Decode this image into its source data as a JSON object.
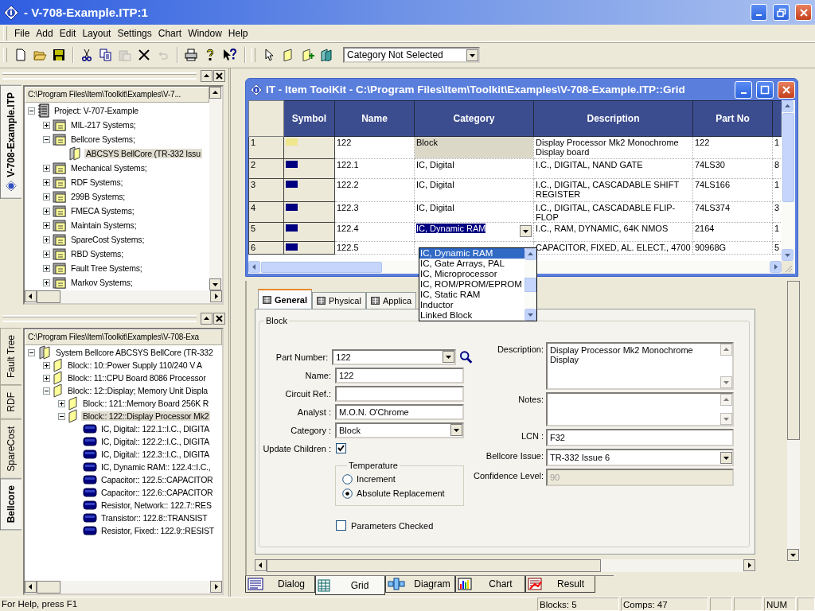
{
  "app": {
    "title": "- V-708-Example.ITP:1"
  },
  "menu": [
    "File",
    "Add",
    "Edit",
    "Layout",
    "Settings",
    "Chart",
    "Window",
    "Help"
  ],
  "toolbar": [
    {
      "kind": "new",
      "disabled": false
    },
    {
      "kind": "open",
      "disabled": false
    },
    {
      "kind": "save",
      "disabled": false
    },
    {
      "kind": "sep"
    },
    {
      "kind": "cut",
      "disabled": false
    },
    {
      "kind": "copy",
      "disabled": false
    },
    {
      "kind": "paste",
      "disabled": true
    },
    {
      "kind": "delete",
      "disabled": false
    },
    {
      "kind": "undo",
      "disabled": true
    },
    {
      "kind": "sep"
    },
    {
      "kind": "print",
      "disabled": false
    },
    {
      "kind": "help",
      "disabled": false
    },
    {
      "kind": "whatsthis",
      "disabled": false
    },
    {
      "kind": "bigsep"
    },
    {
      "kind": "pointer",
      "disabled": false
    },
    {
      "kind": "block",
      "disabled": false
    },
    {
      "kind": "addblock",
      "disabled": false
    },
    {
      "kind": "component",
      "disabled": false
    }
  ],
  "category_filter": {
    "value": "Category Not Selected"
  },
  "project_panel": {
    "tab": "V-708-Example.ITP",
    "path": "C:\\Program Files\\Item\\Toolkit\\Examples\\V-7...",
    "tree": [
      {
        "label": "Project:  V-707-Example",
        "kind": "project",
        "expanded": true,
        "selected": false,
        "children": [
          {
            "label": "MIL-217 Systems;",
            "kind": "folder",
            "expanded": false,
            "selected": false
          },
          {
            "label": "Bellcore Systems;",
            "kind": "folder",
            "expanded": true,
            "selected": false,
            "children": [
              {
                "label": "ABCSYS BellCore (TR-332 Issu",
                "kind": "system",
                "selected": true
              }
            ]
          },
          {
            "label": "Mechanical Systems;",
            "kind": "folder",
            "expanded": false,
            "selected": false
          },
          {
            "label": "RDF Systems;",
            "kind": "folder",
            "expanded": false,
            "selected": false
          },
          {
            "label": "299B Systems;",
            "kind": "folder",
            "expanded": false,
            "selected": false
          },
          {
            "label": "FMECA Systems;",
            "kind": "folder",
            "expanded": false,
            "selected": false
          },
          {
            "label": "Maintain Systems;",
            "kind": "folder",
            "expanded": false,
            "selected": false
          },
          {
            "label": "SpareCost Systems;",
            "kind": "folder",
            "expanded": false,
            "selected": false
          },
          {
            "label": "RBD Systems;",
            "kind": "folder",
            "expanded": false,
            "selected": false
          },
          {
            "label": "Fault Tree Systems;",
            "kind": "folder",
            "expanded": false,
            "selected": false
          },
          {
            "label": "Markov Systems;",
            "kind": "folder",
            "expanded": false,
            "selected": false
          }
        ]
      }
    ]
  },
  "system_panel": {
    "tabs": [
      {
        "label": "Fault Tree",
        "selected": false
      },
      {
        "label": "RDF",
        "selected": false
      },
      {
        "label": "SpareCost",
        "selected": false
      },
      {
        "label": "Bellcore",
        "selected": true
      }
    ],
    "path": "C:\\Program Files\\Item\\Toolkit\\Examples\\V-708-Exa",
    "tree": [
      {
        "label": "System Bellcore ABCSYS BellCore (TR-332",
        "kind": "system",
        "expanded": true,
        "selected": false,
        "children": [
          {
            "label": "Block:: 10::Power Supply 110/240 V A",
            "kind": "block",
            "expanded": false,
            "selected": false
          },
          {
            "label": "Block:: 11::CPU Board 8086 Processor",
            "kind": "block",
            "expanded": false,
            "selected": false
          },
          {
            "label": "Block:: 12::Display; Memory Unit Displa",
            "kind": "block",
            "expanded": true,
            "selected": false,
            "children": [
              {
                "label": "Block:: 121::Memory Board 256K R",
                "kind": "block",
                "expanded": false,
                "selected": false
              },
              {
                "label": "Block:: 122::Display Processor Mk2",
                "kind": "block",
                "expanded": true,
                "selected": true,
                "children": [
                  {
                    "label": "IC, Digital:: 122.1::I.C., DIGITA",
                    "kind": "component",
                    "selected": false
                  },
                  {
                    "label": "IC, Digital:: 122.2::I.C., DIGITA",
                    "kind": "component",
                    "selected": false
                  },
                  {
                    "label": "IC, Digital:: 122.3::I.C., DIGITA",
                    "kind": "component",
                    "selected": false
                  },
                  {
                    "label": "IC, Dynamic RAM:: 122.4::I.C.,",
                    "kind": "component",
                    "selected": false
                  },
                  {
                    "label": "Capacitor:: 122.5::CAPACITOR",
                    "kind": "component",
                    "selected": false
                  },
                  {
                    "label": "Capacitor:: 122.6::CAPACITOR",
                    "kind": "component",
                    "selected": false
                  },
                  {
                    "label": "Resistor, Network:: 122.7::RES",
                    "kind": "component",
                    "selected": false
                  },
                  {
                    "label": "Transistor:: 122.8::TRANSIST",
                    "kind": "component",
                    "selected": false
                  },
                  {
                    "label": "Resistor, Fixed:: 122.9::RESIST",
                    "kind": "component",
                    "selected": false
                  }
                ]
              }
            ]
          }
        ]
      }
    ]
  },
  "grid_window": {
    "title": "IT - Item ToolKit - C:\\Program Files\\Item\\Toolkit\\Examples\\V-708-Example.ITP::Grid",
    "columns": [
      "Symbol",
      "Name",
      "Category",
      "Description",
      "Part No"
    ],
    "rows": [
      {
        "number": "1",
        "color": "#f0e68c",
        "name": "122",
        "category": "Block",
        "category_locked": true,
        "editing": false,
        "description": "Display Processor Mk2 Monochrome Display board",
        "part_no": "122",
        "column_7": "1"
      },
      {
        "number": "2",
        "color": "#000080",
        "name": "122.1",
        "category": "IC, Digital",
        "category_locked": false,
        "editing": false,
        "description": "I.C., DIGITAL, NAND GATE",
        "part_no": "74LS30",
        "column_7": "8"
      },
      {
        "number": "3",
        "color": "#000080",
        "name": "122.2",
        "category": "IC, Digital",
        "category_locked": false,
        "editing": false,
        "description": "I.C., DIGITAL, CASCADABLE SHIFT REGISTER",
        "part_no": "74LS166",
        "column_7": "1"
      },
      {
        "number": "4",
        "color": "#000080",
        "name": "122.3",
        "category": "IC, Digital",
        "category_locked": false,
        "editing": false,
        "description": "I.C., DIGITAL, CASCADABLE FLIP-FLOP",
        "part_no": "74LS374",
        "column_7": "3"
      },
      {
        "number": "5",
        "color": "#000080",
        "name": "122.4",
        "category": "IC, Dynamic RAM",
        "category_locked": false,
        "editing": true,
        "description": "I.C., RAM, DYNAMIC, 64K NMOS",
        "part_no": "2164",
        "column_7": "1"
      },
      {
        "number": "6",
        "color": "#000080",
        "name": "122.5",
        "category_locked": false,
        "editing": false,
        "description": "CAPACITOR, FIXED, AL. ELECT., 4700",
        "part_no": "90968G",
        "column_7": "5"
      }
    ],
    "dropdown": [
      {
        "label": "IC, Dynamic RAM",
        "selected": true
      },
      {
        "label": "IC, Gate Arrays, PAL",
        "selected": false
      },
      {
        "label": "IC, Microprocessor",
        "selected": false
      },
      {
        "label": "IC, ROM/PROM/EPROM",
        "selected": false
      },
      {
        "label": "IC, Static RAM",
        "selected": false
      },
      {
        "label": "Inductor",
        "selected": false
      },
      {
        "label": "Linked Block",
        "selected": false
      }
    ]
  },
  "dialog": {
    "tabs": [
      {
        "label": "General",
        "selected": true
      },
      {
        "label": "Physical",
        "selected": false
      },
      {
        "label": "Applica",
        "selected": false
      }
    ],
    "group": "Block",
    "left_fields": [
      {
        "kind": "combo",
        "label": "Part Number:",
        "value": "122",
        "lookup": true
      },
      {
        "kind": "text",
        "label": "Name:",
        "value": "122"
      },
      {
        "kind": "text",
        "label": "Circuit Ref.:"
      },
      {
        "kind": "text",
        "label": "Analyst :",
        "value": "M.O.N. O'Chrome"
      },
      {
        "kind": "combo",
        "label": "Category :",
        "value": "Block"
      },
      {
        "kind": "checkbox",
        "label": "Update Children :",
        "checked": true
      }
    ],
    "temperature": {
      "title": "Temperature",
      "options": [
        {
          "label": "Increment",
          "selected": false
        },
        {
          "label": "Absolute Replacement",
          "selected": true
        }
      ]
    },
    "parameters_checked": {
      "label": "Parameters Checked",
      "checked": false
    },
    "right_fields": [
      {
        "kind": "memo",
        "label": "Description:",
        "value": "Display Processor Mk2 Monochrome Display",
        "disabled": false
      },
      {
        "kind": "memo",
        "label": "Notes:",
        "disabled": false
      },
      {
        "kind": "text",
        "label": "LCN :",
        "value": "F32",
        "disabled": false
      },
      {
        "kind": "combo",
        "label": "Bellcore Issue:",
        "value": "TR-332 Issue 6",
        "disabled": false
      },
      {
        "kind": "text",
        "label": "Confidence Level:",
        "value": "90",
        "disabled": true
      }
    ]
  },
  "view_tabs": [
    {
      "label": "Dialog",
      "kind": "dialog",
      "selected": false
    },
    {
      "label": "Grid",
      "kind": "grid",
      "selected": true
    },
    {
      "label": "Diagram",
      "kind": "diagram",
      "selected": false
    },
    {
      "label": "Chart",
      "kind": "chart",
      "selected": false
    },
    {
      "label": "Result",
      "kind": "result",
      "selected": false
    }
  ],
  "status_bar": {
    "help": "For Help, press F1",
    "blocks": "Blocks: 5",
    "comps": "Comps: 47",
    "num": "NUM"
  }
}
